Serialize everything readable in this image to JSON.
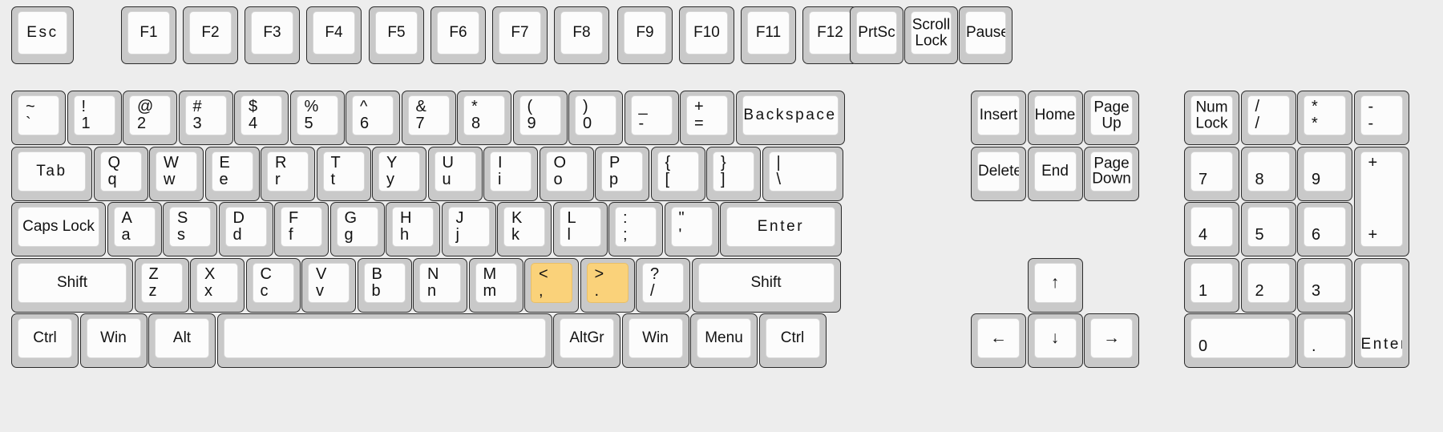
{
  "meta": {
    "title": "Full-size 104-key keyboard layout",
    "background_color": "#ededed",
    "key_bezel_color": "#c9c9c9",
    "keycap_color": "#fcfcfc",
    "highlight_color": "#fad27a",
    "highlighted_keys": [
      "comma",
      "period"
    ]
  },
  "function_row": [
    {
      "name": "esc",
      "label": "Esc",
      "style": "spaced"
    },
    {
      "name": "f1",
      "label": "F1"
    },
    {
      "name": "f2",
      "label": "F2"
    },
    {
      "name": "f3",
      "label": "F3"
    },
    {
      "name": "f4",
      "label": "F4"
    },
    {
      "name": "f5",
      "label": "F5"
    },
    {
      "name": "f6",
      "label": "F6"
    },
    {
      "name": "f7",
      "label": "F7"
    },
    {
      "name": "f8",
      "label": "F8"
    },
    {
      "name": "f9",
      "label": "F9"
    },
    {
      "name": "f10",
      "label": "F10"
    },
    {
      "name": "f11",
      "label": "F11"
    },
    {
      "name": "f12",
      "label": "F12"
    },
    {
      "name": "prtsc",
      "label": "PrtSc"
    },
    {
      "name": "scroll-lock",
      "label": "Scroll\nLock"
    },
    {
      "name": "pause",
      "label": "Pause"
    }
  ],
  "number_row": [
    {
      "name": "backtick",
      "top": "~",
      "bottom": "`"
    },
    {
      "name": "digit-1",
      "top": "!",
      "bottom": "1"
    },
    {
      "name": "digit-2",
      "top": "@",
      "bottom": "2"
    },
    {
      "name": "digit-3",
      "top": "#",
      "bottom": "3"
    },
    {
      "name": "digit-4",
      "top": "$",
      "bottom": "4"
    },
    {
      "name": "digit-5",
      "top": "%",
      "bottom": "5"
    },
    {
      "name": "digit-6",
      "top": "^",
      "bottom": "6"
    },
    {
      "name": "digit-7",
      "top": "&",
      "bottom": "7"
    },
    {
      "name": "digit-8",
      "top": "*",
      "bottom": "8"
    },
    {
      "name": "digit-9",
      "top": "(",
      "bottom": "9"
    },
    {
      "name": "digit-0",
      "top": ")",
      "bottom": "0"
    },
    {
      "name": "minus",
      "top": "_",
      "bottom": "-"
    },
    {
      "name": "equals",
      "top": "+",
      "bottom": "="
    },
    {
      "name": "backspace",
      "label": "Backspace",
      "style": "spaced"
    }
  ],
  "tab_row": [
    {
      "name": "tab",
      "label": "Tab",
      "style": "spaced"
    },
    {
      "name": "key-q",
      "top": "Q",
      "bottom": "q"
    },
    {
      "name": "key-w",
      "top": "W",
      "bottom": "w"
    },
    {
      "name": "key-e",
      "top": "E",
      "bottom": "e"
    },
    {
      "name": "key-r",
      "top": "R",
      "bottom": "r"
    },
    {
      "name": "key-t",
      "top": "T",
      "bottom": "t"
    },
    {
      "name": "key-y",
      "top": "Y",
      "bottom": "y"
    },
    {
      "name": "key-u",
      "top": "U",
      "bottom": "u"
    },
    {
      "name": "key-i",
      "top": "I",
      "bottom": "i"
    },
    {
      "name": "key-o",
      "top": "O",
      "bottom": "o"
    },
    {
      "name": "key-p",
      "top": "P",
      "bottom": "p"
    },
    {
      "name": "bracket-left",
      "top": "{",
      "bottom": "["
    },
    {
      "name": "bracket-right",
      "top": "}",
      "bottom": "]"
    },
    {
      "name": "backslash",
      "top": "|",
      "bottom": "\\"
    }
  ],
  "home_row": [
    {
      "name": "caps-lock",
      "label": "Caps Lock"
    },
    {
      "name": "key-a",
      "top": "A",
      "bottom": "a"
    },
    {
      "name": "key-s",
      "top": "S",
      "bottom": "s"
    },
    {
      "name": "key-d",
      "top": "D",
      "bottom": "d"
    },
    {
      "name": "key-f",
      "top": "F",
      "bottom": "f"
    },
    {
      "name": "key-g",
      "top": "G",
      "bottom": "g"
    },
    {
      "name": "key-h",
      "top": "H",
      "bottom": "h"
    },
    {
      "name": "key-j",
      "top": "J",
      "bottom": "j"
    },
    {
      "name": "key-k",
      "top": "K",
      "bottom": "k"
    },
    {
      "name": "key-l",
      "top": "L",
      "bottom": "l"
    },
    {
      "name": "semicolon",
      "top": ":",
      "bottom": ";"
    },
    {
      "name": "quote",
      "top": "\"",
      "bottom": "'"
    },
    {
      "name": "enter",
      "label": "Enter",
      "style": "spaced"
    }
  ],
  "shift_row": [
    {
      "name": "shift-left",
      "label": "Shift"
    },
    {
      "name": "key-z",
      "top": "Z",
      "bottom": "z"
    },
    {
      "name": "key-x",
      "top": "X",
      "bottom": "x"
    },
    {
      "name": "key-c",
      "top": "C",
      "bottom": "c"
    },
    {
      "name": "key-v",
      "top": "V",
      "bottom": "v"
    },
    {
      "name": "key-b",
      "top": "B",
      "bottom": "b"
    },
    {
      "name": "key-n",
      "top": "N",
      "bottom": "n"
    },
    {
      "name": "key-m",
      "top": "M",
      "bottom": "m"
    },
    {
      "name": "comma",
      "top": "<",
      "bottom": ",",
      "highlighted": true
    },
    {
      "name": "period",
      "top": ">",
      "bottom": ".",
      "highlighted": true
    },
    {
      "name": "slash",
      "top": "?",
      "bottom": "/"
    },
    {
      "name": "shift-right",
      "label": "Shift"
    }
  ],
  "bottom_row": [
    {
      "name": "ctrl-left",
      "label": "Ctrl"
    },
    {
      "name": "win-left",
      "label": "Win"
    },
    {
      "name": "alt-left",
      "label": "Alt"
    },
    {
      "name": "space",
      "label": ""
    },
    {
      "name": "altgr",
      "label": "AltGr"
    },
    {
      "name": "win-right",
      "label": "Win"
    },
    {
      "name": "menu",
      "label": "Menu"
    },
    {
      "name": "ctrl-right",
      "label": "Ctrl"
    }
  ],
  "nav_cluster": [
    {
      "name": "insert",
      "label": "Insert"
    },
    {
      "name": "home",
      "label": "Home"
    },
    {
      "name": "page-up",
      "label": "Page\nUp"
    },
    {
      "name": "delete",
      "label": "Delete"
    },
    {
      "name": "end",
      "label": "End"
    },
    {
      "name": "page-down",
      "label": "Page\nDown"
    }
  ],
  "arrow_cluster": [
    {
      "name": "arrow-up-key",
      "label": "↑"
    },
    {
      "name": "arrow-left-key",
      "label": "←"
    },
    {
      "name": "arrow-down-key",
      "label": "↓"
    },
    {
      "name": "arrow-right-key",
      "label": "→"
    }
  ],
  "numpad": [
    {
      "name": "num-lock",
      "label": "Num\nLock"
    },
    {
      "name": "numpad-divide",
      "top": "/",
      "bottom": "/"
    },
    {
      "name": "numpad-multiply",
      "top": "*",
      "bottom": "*"
    },
    {
      "name": "numpad-minus",
      "top": "-",
      "bottom": "-"
    },
    {
      "name": "numpad-7",
      "bottom": "7"
    },
    {
      "name": "numpad-8",
      "bottom": "8"
    },
    {
      "name": "numpad-9",
      "bottom": "9"
    },
    {
      "name": "numpad-plus",
      "top": "+",
      "bottom": "+"
    },
    {
      "name": "numpad-4",
      "bottom": "4"
    },
    {
      "name": "numpad-5",
      "bottom": "5"
    },
    {
      "name": "numpad-6",
      "bottom": "6"
    },
    {
      "name": "numpad-1",
      "bottom": "1"
    },
    {
      "name": "numpad-2",
      "bottom": "2"
    },
    {
      "name": "numpad-3",
      "bottom": "3"
    },
    {
      "name": "numpad-enter",
      "label": "Enter",
      "style": "spaced"
    },
    {
      "name": "numpad-0",
      "bottom": "0"
    },
    {
      "name": "numpad-decimal",
      "bottom": "."
    }
  ]
}
